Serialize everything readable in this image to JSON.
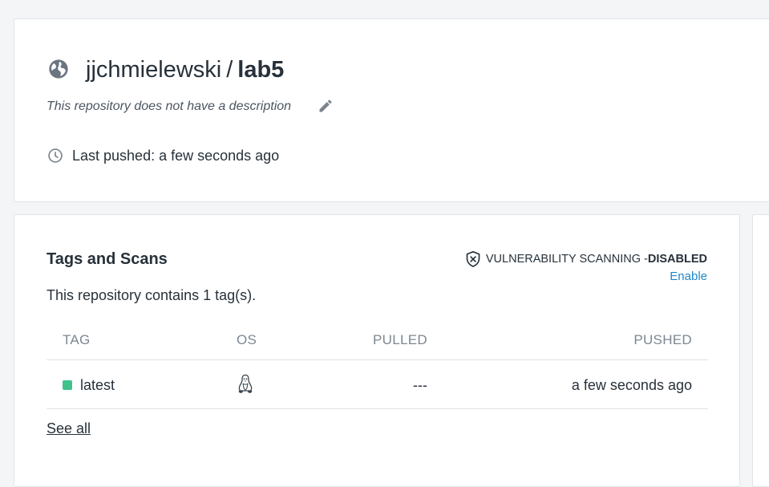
{
  "repo": {
    "namespace": "jjchmielewski",
    "separator": "/",
    "name": "lab5",
    "description": "This repository does not have a description",
    "last_pushed": "Last pushed: a few seconds ago"
  },
  "tags_section": {
    "title": "Tags and Scans",
    "scan_label": "VULNERABILITY SCANNING - ",
    "scan_state": "DISABLED",
    "enable_link": "Enable",
    "count_text": "This repository contains 1 tag(s).",
    "columns": {
      "tag": "TAG",
      "os": "OS",
      "pulled": "PULLED",
      "pushed": "PUSHED"
    },
    "rows": [
      {
        "tag": "latest",
        "os": "linux-icon",
        "pulled": "---",
        "pushed": "a few seconds ago",
        "status_color": "#3fc28c"
      }
    ],
    "see_all": "See all"
  },
  "icons": {
    "visibility": "globe-icon",
    "edit": "pencil-icon",
    "time": "clock-icon",
    "scan": "shield-x-icon"
  },
  "colors": {
    "link": "#1e88c8",
    "tag_status": "#3fc28c",
    "background": "#f4f5f7"
  }
}
